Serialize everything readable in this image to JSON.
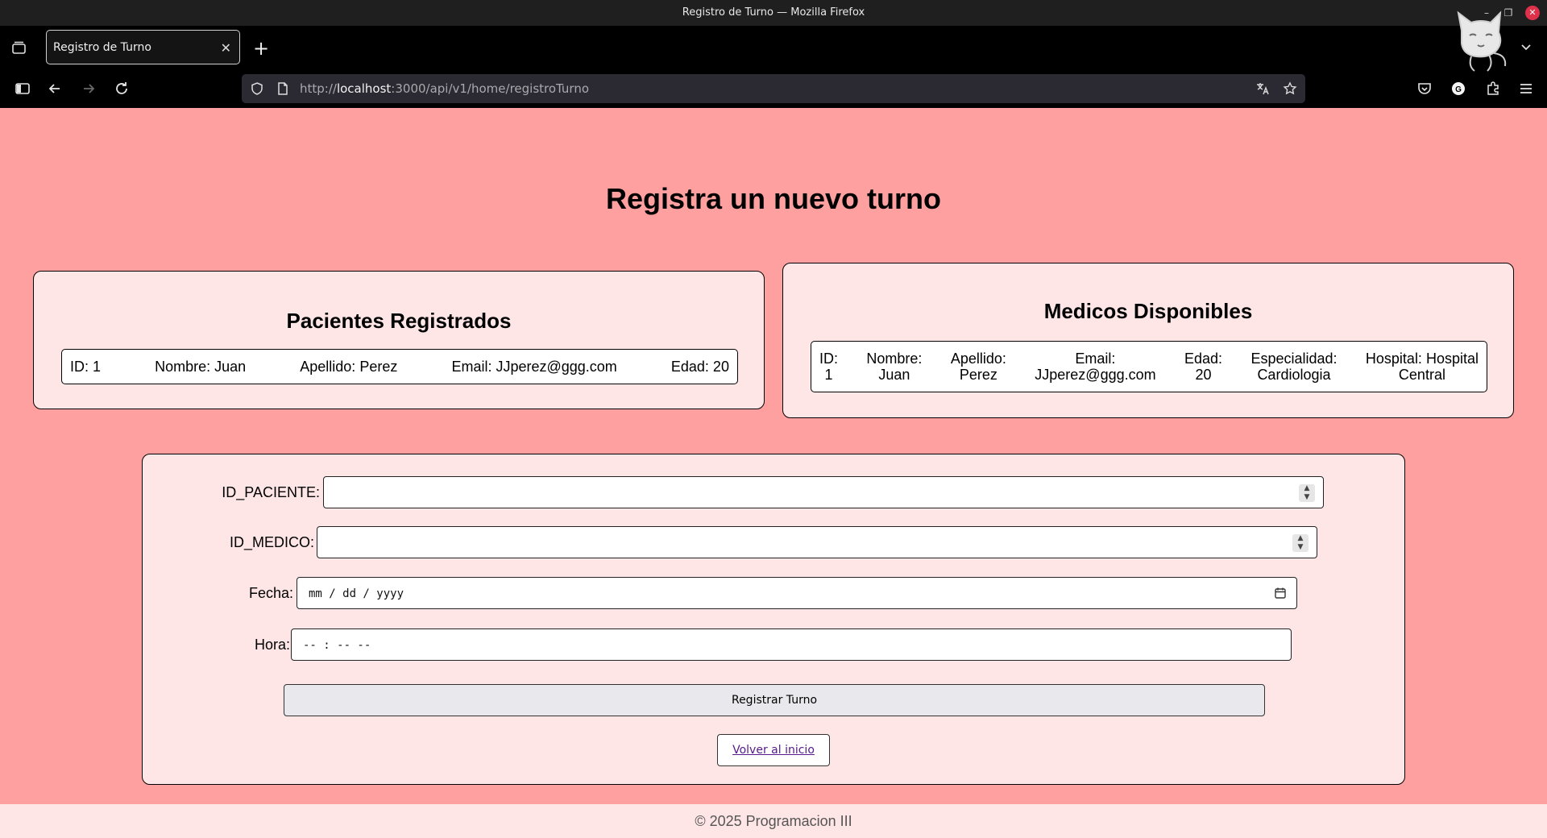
{
  "browser": {
    "window_title": "Registro de Turno — Mozilla Firefox",
    "tab_title": "Registro de Turno",
    "url_prefix": "http://",
    "url_host": "localhost",
    "url_rest": ":3000/api/v1/home/registroTurno"
  },
  "page": {
    "title": "Registra un nuevo turno"
  },
  "pacientes": {
    "heading": "Pacientes Registrados",
    "rows": [
      {
        "id": "ID: 1",
        "nombre": "Nombre: Juan",
        "apellido": "Apellido: Perez",
        "email": "Email: JJperez@ggg.com",
        "edad": "Edad: 20"
      }
    ]
  },
  "medicos": {
    "heading": "Medicos Disponibles",
    "rows": [
      {
        "id_label": "ID:",
        "id_value": "1",
        "nombre_label": "Nombre:",
        "nombre_value": "Juan",
        "apellido_label": "Apellido:",
        "apellido_value": "Perez",
        "email_label": "Email:",
        "email_value": "JJperez@ggg.com",
        "edad_label": "Edad:",
        "edad_value": "20",
        "especialidad_label": "Especialidad:",
        "especialidad_value": "Cardiologia",
        "hospital_label": "Hospital: Hospital",
        "hospital_value": "Central"
      }
    ]
  },
  "form": {
    "id_paciente_label": "ID_PACIENTE:",
    "id_paciente_value": "",
    "id_medico_label": "ID_MEDICO:",
    "id_medico_value": "",
    "fecha_label": "Fecha:",
    "fecha_placeholder": "mm / dd / yyyy",
    "hora_label": "Hora:",
    "hora_placeholder": "-- : --  --",
    "submit_label": "Registrar Turno",
    "back_label": "Volver al inicio"
  },
  "footer": {
    "text": "© 2025 Programacion III"
  },
  "colors": {
    "page_bg": "#ffa0a0",
    "card_bg": "#ffe6e6",
    "link": "#551a8b"
  }
}
